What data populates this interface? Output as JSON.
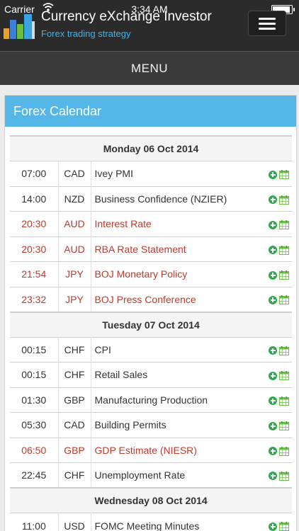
{
  "status_bar": {
    "carrier": "Carrier",
    "time": "3:34 AM"
  },
  "header": {
    "title": "Currency eXchange Investor",
    "subtitle": "Forex trading strategy",
    "menu_label": "MENU"
  },
  "colors": {
    "accent": "#55b7e8",
    "high_impact": "#c0392b",
    "add_green": "#2fa84f",
    "subtitle_blue": "#3fb6ef"
  },
  "panel": {
    "title": "Forex Calendar"
  },
  "calendar": {
    "days": [
      {
        "date": "Monday 06 Oct 2014",
        "events": [
          {
            "time": "07:00",
            "currency": "CAD",
            "event": "Ivey PMI",
            "high": false
          },
          {
            "time": "14:00",
            "currency": "NZD",
            "event": "Business Confidence (NZIER)",
            "high": false
          },
          {
            "time": "20:30",
            "currency": "AUD",
            "event": "Interest Rate",
            "high": true
          },
          {
            "time": "20:30",
            "currency": "AUD",
            "event": "RBA Rate Statement",
            "high": true
          },
          {
            "time": "21:54",
            "currency": "JPY",
            "event": "BOJ Monetary Policy",
            "high": true
          },
          {
            "time": "23:32",
            "currency": "JPY",
            "event": "BOJ Press Conference",
            "high": true
          }
        ]
      },
      {
        "date": "Tuesday 07 Oct 2014",
        "events": [
          {
            "time": "00:15",
            "currency": "CHF",
            "event": "CPI",
            "high": false
          },
          {
            "time": "00:15",
            "currency": "CHF",
            "event": "Retail Sales",
            "high": false
          },
          {
            "time": "01:30",
            "currency": "GBP",
            "event": "Manufacturing Production",
            "high": false
          },
          {
            "time": "05:30",
            "currency": "CAD",
            "event": "Building Permits",
            "high": false
          },
          {
            "time": "06:50",
            "currency": "GBP",
            "event": "GDP Estimate (NIESR)",
            "high": true
          },
          {
            "time": "22:45",
            "currency": "CHF",
            "event": "Unemployment Rate",
            "high": false
          }
        ]
      },
      {
        "date": "Wednesday 08 Oct 2014",
        "events": [
          {
            "time": "11:00",
            "currency": "USD",
            "event": "FOMC Meeting Minutes",
            "high": false
          }
        ]
      }
    ]
  }
}
